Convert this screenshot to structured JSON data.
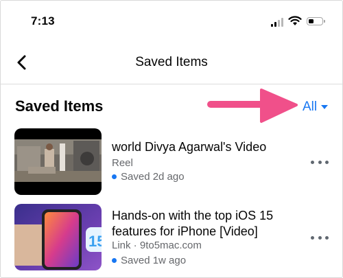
{
  "status": {
    "time": "7:13"
  },
  "nav": {
    "title": "Saved Items"
  },
  "section": {
    "title": "Saved Items",
    "filter_label": "All"
  },
  "items": [
    {
      "title": "world Divya Agarwal's Video",
      "meta": "Reel",
      "saved": "Saved 2d ago"
    },
    {
      "title": "Hands-on with the top iOS 15 features for iPhone [Video]",
      "meta": "Link · 9to5mac.com",
      "saved": "Saved 1w ago"
    }
  ],
  "colors": {
    "accent": "#1877f2",
    "annotation_arrow": "#f0508a",
    "text": "#050505",
    "secondary_text": "#65676b"
  },
  "icons": [
    "back-chevron-icon",
    "signal-icon",
    "wifi-icon",
    "battery-icon",
    "dropdown-caret-icon",
    "more-options-icon"
  ]
}
